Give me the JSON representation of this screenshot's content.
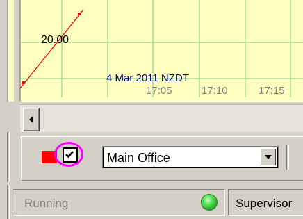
{
  "chart": {
    "y_label": "20.00",
    "date_label": "4 Mar 2011 NZDT",
    "x_ticks": [
      "17:05",
      "17:10",
      "17:15"
    ],
    "series_color": "#ff0000",
    "grid_color": "#7ccd7c",
    "background_color": "#ffffc0"
  },
  "toolbar": {
    "color_swatch": "#ff0000",
    "checkbox_checked": true,
    "location_value": "Main Office"
  },
  "status": {
    "state_text": "Running",
    "led_color": "#3cc83c",
    "user_text": "Supervisor"
  }
}
